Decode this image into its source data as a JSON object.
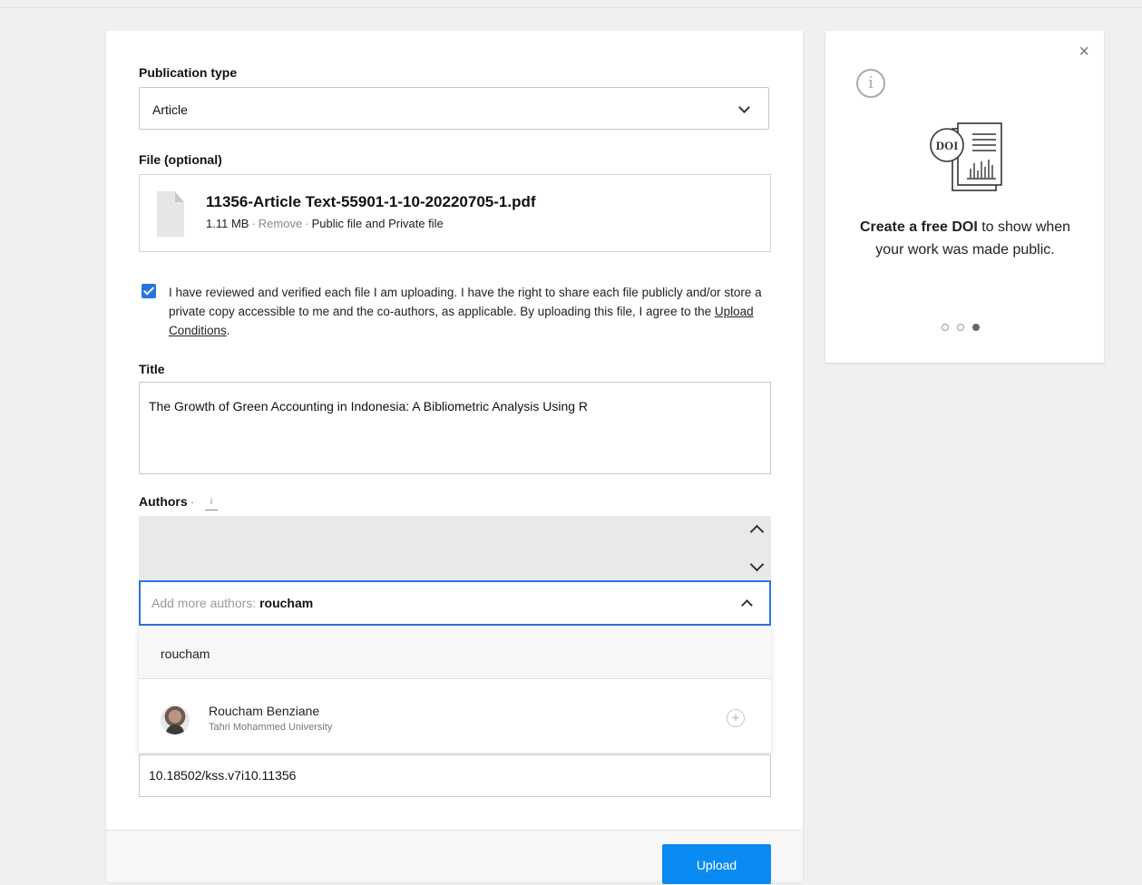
{
  "form": {
    "publication_type_label": "Publication type",
    "publication_type_value": "Article",
    "file_label": "File (optional)",
    "file": {
      "name": "11356-Article Text-55901-1-10-20220705-1.pdf",
      "size": "1.11 MB",
      "remove": "Remove",
      "visibility": "Public file and Private file"
    },
    "consent": {
      "checked": true,
      "text": "I have reviewed and verified each file I am uploading. I have the right to share each file publicly and/or store a private copy accessible to me and the co-authors, as applicable. By uploading this file, I agree to the ",
      "link": "Upload Conditions",
      "end": "."
    },
    "title_label": "Title",
    "title_value": "The Growth of Green Accounting in Indonesia: A Bibliometric Analysis Using R",
    "authors_label": "Authors",
    "authors_info": "i",
    "add_authors_placeholder": "Add more authors: ",
    "add_authors_value": "roucham",
    "dropdown": {
      "query": "roucham",
      "suggestion_name": "Roucham Benziane",
      "suggestion_affiliation": "Tahri Mohammed University"
    },
    "doi_value": "10.18502/kss.v7i10.11356",
    "upload_button": "Upload"
  },
  "promo": {
    "close": "×",
    "info": "i",
    "doi_badge": "DOI",
    "text_bold": "Create a free DOI",
    "text_rest": " to show when your work was made public.",
    "carousel_active": 3,
    "carousel_total": 3
  },
  "colors": {
    "accent": "#2874e0",
    "button": "#0a8af3",
    "background": "#f0f0f0"
  }
}
